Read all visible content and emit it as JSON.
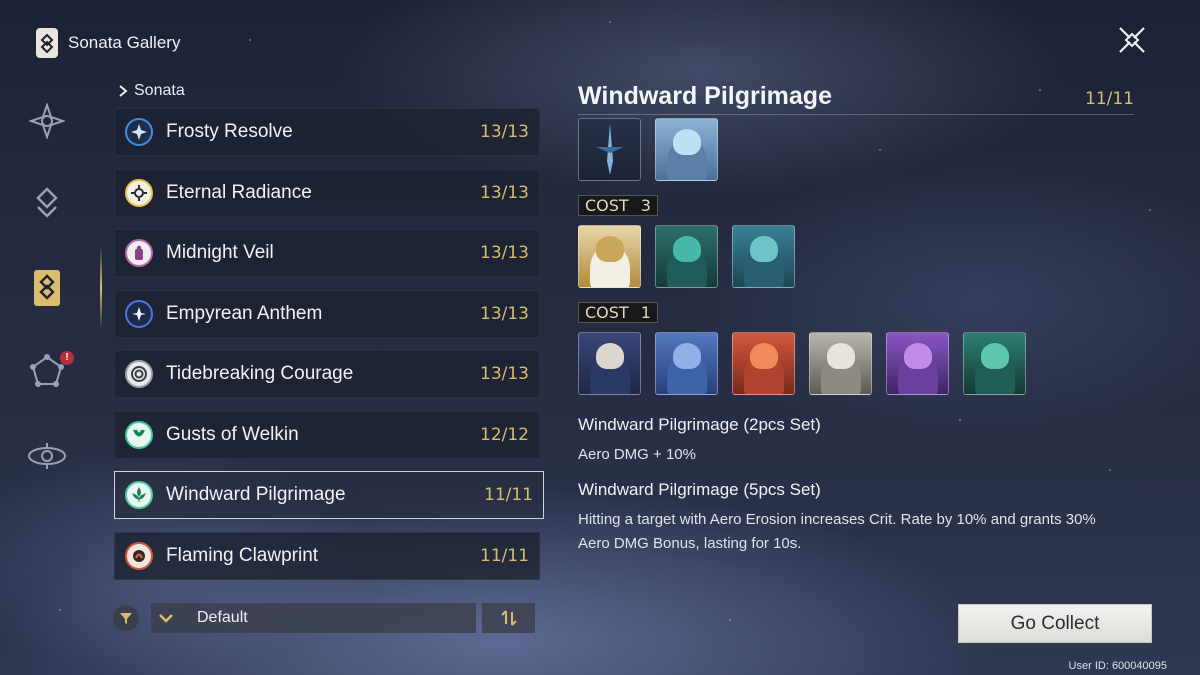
{
  "header": {
    "title": "Sonata Gallery"
  },
  "nav": {
    "items": [
      {
        "icon": "echo-compass-icon",
        "active": false
      },
      {
        "icon": "layered-diamond-icon",
        "active": false
      },
      {
        "icon": "sonata-book-icon",
        "active": true
      },
      {
        "icon": "constellation-icon",
        "active": false,
        "badge": "!"
      },
      {
        "icon": "orbit-ring-icon",
        "active": false
      }
    ]
  },
  "list": {
    "heading": "Sonata",
    "items": [
      {
        "name": "Frosty Resolve",
        "count": "13/13",
        "icon": "frost-star-icon",
        "color": "#3f8fe0"
      },
      {
        "name": "Eternal Radiance",
        "count": "13/13",
        "icon": "radiant-sun-icon",
        "color": "#e8c64a"
      },
      {
        "name": "Midnight Veil",
        "count": "13/13",
        "icon": "veil-figure-icon",
        "color": "#b26aa8"
      },
      {
        "name": "Empyrean Anthem",
        "count": "13/13",
        "icon": "anthem-star-icon",
        "color": "#4d76d8"
      },
      {
        "name": "Tidebreaking Courage",
        "count": "13/13",
        "icon": "tide-spiral-icon",
        "color": "#9aa0ad"
      },
      {
        "name": "Gusts of Welkin",
        "count": "12/12",
        "icon": "welkin-gust-icon",
        "color": "#3ec9a0"
      },
      {
        "name": "Windward Pilgrimage",
        "count": "11/11",
        "icon": "windward-fleur-icon",
        "color": "#4fcf9f",
        "selected": true
      },
      {
        "name": "Flaming Clawprint",
        "count": "11/11",
        "icon": "flame-claw-icon",
        "color": "#d4553a"
      }
    ]
  },
  "filter": {
    "sort_value": "Default"
  },
  "detail": {
    "title": "Windward Pilgrimage",
    "count": "11/11",
    "top_echoes": [
      {
        "name": "blade-echo",
        "base": "#2a3b56",
        "accent": "#7fb4e0"
      },
      {
        "name": "winged-dragon-echo",
        "base": "#5b7fa7",
        "accent": "#b9e2f2"
      }
    ],
    "cost3": {
      "label": "COST",
      "value": "3",
      "echoes": [
        {
          "name": "golden-knight-echo",
          "base": "#c9a75a",
          "accent": "#f2efe6"
        },
        {
          "name": "teal-dragon-echo",
          "base": "#1f5c5a",
          "accent": "#48b8ad"
        },
        {
          "name": "cyan-beast-echo",
          "base": "#2a5f73",
          "accent": "#6cc4c9"
        }
      ]
    },
    "cost1": {
      "label": "COST",
      "value": "1",
      "echoes": [
        {
          "name": "hooded-sage-echo",
          "base": "#2b3a64",
          "accent": "#d9d7cf"
        },
        {
          "name": "blue-drake-echo",
          "base": "#3f63a8",
          "accent": "#8fb0e8"
        },
        {
          "name": "red-drake-echo",
          "base": "#b2432f",
          "accent": "#ef8a5a"
        },
        {
          "name": "white-drake-echo",
          "base": "#8c8a82",
          "accent": "#e6e3da"
        },
        {
          "name": "violet-drake-echo",
          "base": "#6a3f9e",
          "accent": "#c48ae8"
        },
        {
          "name": "jade-drake-echo",
          "base": "#1f5d55",
          "accent": "#5dc6ad"
        }
      ]
    },
    "set2": {
      "title": "Windward Pilgrimage (2pcs Set)",
      "text": "Aero DMG + 10%"
    },
    "set5": {
      "title": "Windward Pilgrimage (5pcs Set)",
      "text": "Hitting a target with Aero Erosion increases Crit. Rate by 10% and grants 30% Aero DMG Bonus, lasting for 10s."
    }
  },
  "actions": {
    "collect_label": "Go Collect"
  },
  "footer": {
    "user_id": "User ID: 600040095"
  }
}
